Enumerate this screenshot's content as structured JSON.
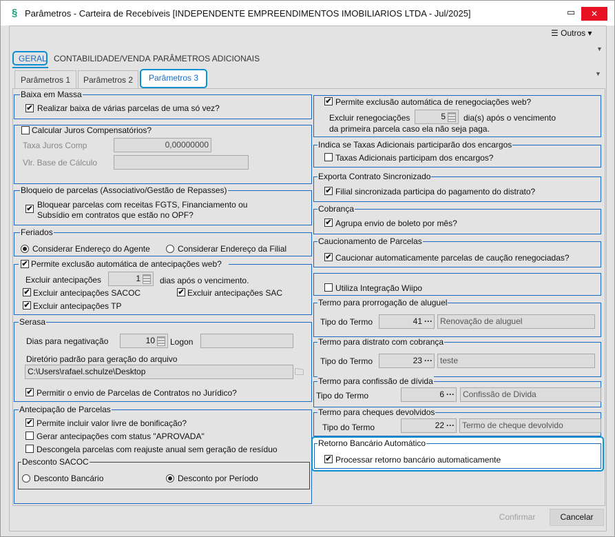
{
  "window": {
    "title": "Parâmetros - Carteira de Recebíveis [INDEPENDENTE EMPREENDIMENTOS IMOBILIARIOS LTDA - Jul/2025]",
    "minimize": "▭",
    "close": "✕",
    "accent": "#1b6ac0",
    "highlight": "#0a8fd0"
  },
  "toolbar": {
    "outros": "Outros"
  },
  "tabs": [
    "GERAL",
    "CONTABILIDADE/VENDA",
    "PARÂMETROS ADICIONAIS"
  ],
  "subtabs": [
    "Parâmetros 1",
    "Parâmetros 2",
    "Parâmetros 3"
  ],
  "left": {
    "baixa": {
      "title": "Baixa em Massa",
      "check": "Realizar baixa de várias parcelas de uma só vez?",
      "checked": true
    },
    "juros": {
      "title": "Calcular Juros Compensatórios?",
      "checked": false,
      "taxa_label": "Taxa Juros Comp",
      "taxa_value": "0,00000000",
      "base_label": "Vlr. Base de Cálculo",
      "base_value": ""
    },
    "bloqueio": {
      "title": "Bloqueio de parcelas (Associativo/Gestão de Repasses)",
      "line1": "Bloquear parcelas com receitas FGTS, Financiamento ou",
      "line2": "Subsídio em contratos que estão no OPF?",
      "checked": true
    },
    "feriados": {
      "title": "Feriados",
      "opt1": "Considerar Endereço do Agente",
      "opt2": "Considerar Endereço da Filial",
      "selected": 1
    },
    "antecip_web": {
      "title": "Permite exclusão automática de antecipações web?",
      "checked": true,
      "excluir_label": "Excluir antecipações",
      "excluir_value": "1",
      "dias": "dias após o vencimento.",
      "sacoc": "Excluir antecipações SACOC",
      "sac": "Excluir antecipações SAC",
      "tp": "Excluir antecipações TP"
    },
    "serasa": {
      "title": "Serasa",
      "dias_label": "Dias para negativação",
      "dias_value": "10",
      "logon_label": "Logon",
      "logon_value": "",
      "dir_label": "Diretório padrão para geração do arquivo",
      "dir_value": "C:\\Users\\rafael.schulze\\Desktop",
      "juridico": "Permitir o envio de Parcelas de Contratos no Jurídico?",
      "juridico_checked": true
    },
    "antecipacao": {
      "title": "Antecipação de Parcelas",
      "c1": "Permite incluir valor livre de bonificação?",
      "c2": "Gerar antecipações com status \"APROVADA\"",
      "c3": "Descongela parcelas com reajuste anual sem geração de resíduo",
      "checked": [
        true,
        false,
        false
      ],
      "sacoc_title": "Desconto SACOC",
      "opt1": "Desconto Bancário",
      "opt2": "Desconto por Período",
      "selected": 2
    }
  },
  "right": {
    "reneg": {
      "title": "Permite exclusão automática de renegociações web?",
      "checked": true,
      "label": "Excluir renegociações",
      "value": "5",
      "after": "dia(s) após o vencimento",
      "line2": "da primeira parcela caso ela não seja paga."
    },
    "taxas": {
      "title": "Indica se Taxas Adicionais participarão dos encargos",
      "check": "Taxas Adicionais participam dos encargos?",
      "checked": false
    },
    "exporta": {
      "title": "Exporta Contrato Sincronizado",
      "check": "Filial sincronizada participa do pagamento do distrato?",
      "checked": true
    },
    "cobranca": {
      "title": "Cobrança",
      "check": "Agrupa envio de boleto por mês?",
      "checked": true
    },
    "caucao": {
      "title": "Caucionamento de Parcelas",
      "check": "Caucionar automaticamente parcelas de caução renegociadas?",
      "checked": true
    },
    "wiipo": {
      "check": "Utiliza Integração Wiipo",
      "checked": false
    },
    "termos": [
      {
        "title": "Termo para prorrogação de aluguel",
        "label": "Tipo do Termo",
        "code": "41",
        "desc": "Renovação de aluguel"
      },
      {
        "title": "Termo para distrato com cobrança",
        "label": "Tipo do Termo",
        "code": "23",
        "desc": "teste"
      },
      {
        "title": "Termo para confissão de dívida",
        "label": "Tipo do Termo",
        "code": "6",
        "desc": "Confissão de Divida"
      },
      {
        "title": "Termo para cheques devolvidos",
        "label": "Tipo do Termo",
        "code": "22",
        "desc": "Termo de cheque devolvido"
      }
    ],
    "retorno": {
      "title": "Retorno Bancário Automático",
      "check": "Processar retorno bancário automaticamente",
      "checked": true
    }
  },
  "footer": {
    "confirmar": "Confirmar",
    "cancelar": "Cancelar"
  }
}
